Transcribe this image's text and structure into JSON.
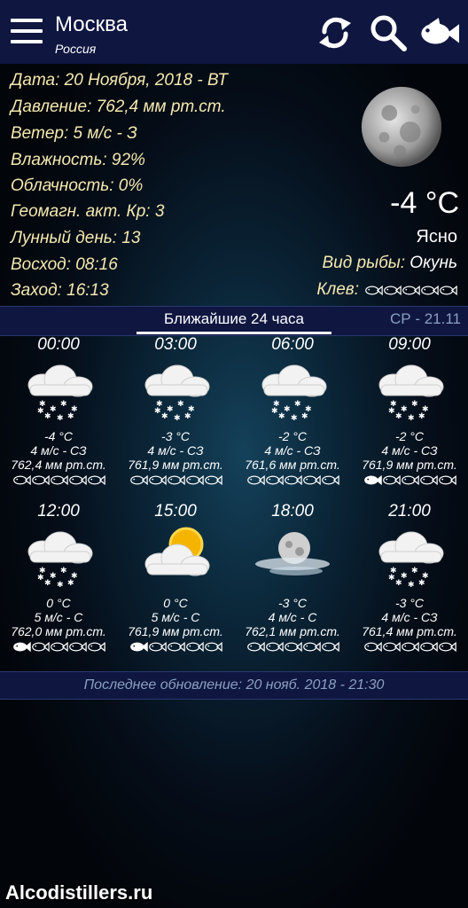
{
  "header": {
    "city": "Москва",
    "country": "Россия",
    "menu_icon": "hamburger-menu-icon",
    "refresh_icon": "refresh-icon",
    "search_icon": "search-icon",
    "fish_icon": "fish-icon"
  },
  "current": {
    "date": "Дата: 20 Ноября, 2018 - ВТ",
    "pressure": "Давление: 762,4 мм рт.ст.",
    "wind": "Ветер: 5 м/с - З",
    "humidity": "Влажность: 92%",
    "cloudiness": "Облачность: 0%",
    "geomagnetic": "Геомагн. акт. Кр: 3",
    "lunar_day": "Лунный день: 13",
    "sunrise": "Восход: 08:16",
    "sunset": "Заход: 16:13",
    "temperature": "-4 °C",
    "condition": "Ясно",
    "fish_label": "Вид рыбы:",
    "fish_value": "Окунь",
    "bite_label": "Клев:",
    "bite_level": 0
  },
  "tabs": {
    "active": "Ближайшие 24 часа",
    "next": "СР - 21.11"
  },
  "hourly": [
    {
      "time": "00:00",
      "icon": "snow-cloud",
      "temp": "-4 °C",
      "wind": "4 м/с - СЗ",
      "pressure": "762,4 мм рт.ст.",
      "bite": 0
    },
    {
      "time": "03:00",
      "icon": "snow-cloud",
      "temp": "-3 °C",
      "wind": "4 м/с - СЗ",
      "pressure": "761,9 мм рт.ст.",
      "bite": 0
    },
    {
      "time": "06:00",
      "icon": "snow-cloud",
      "temp": "-2 °C",
      "wind": "4 м/с - СЗ",
      "pressure": "761,6 мм рт.ст.",
      "bite": 0
    },
    {
      "time": "09:00",
      "icon": "snow-cloud",
      "temp": "-2 °C",
      "wind": "4 м/с - СЗ",
      "pressure": "761,9 мм рт.ст.",
      "bite": 1
    },
    {
      "time": "12:00",
      "icon": "snow-cloud",
      "temp": "0 °C",
      "wind": "5 м/с - С",
      "pressure": "762,0 мм рт.ст.",
      "bite": 1
    },
    {
      "time": "15:00",
      "icon": "sun-cloud",
      "temp": "0 °C",
      "wind": "5 м/с - С",
      "pressure": "761,9 мм рт.ст.",
      "bite": 1
    },
    {
      "time": "18:00",
      "icon": "moon-fog",
      "temp": "-3 °C",
      "wind": "4 м/с - С",
      "pressure": "762,1 мм рт.ст.",
      "bite": 0
    },
    {
      "time": "21:00",
      "icon": "snow-cloud",
      "temp": "-3 °C",
      "wind": "4 м/с - СЗ",
      "pressure": "761,4 мм рт.ст.",
      "bite": 0
    }
  ],
  "footer": {
    "last_update": "Последнее обновление: 20 нояб. 2018 - 21:30"
  },
  "watermark": "Alcodistillers.ru"
}
